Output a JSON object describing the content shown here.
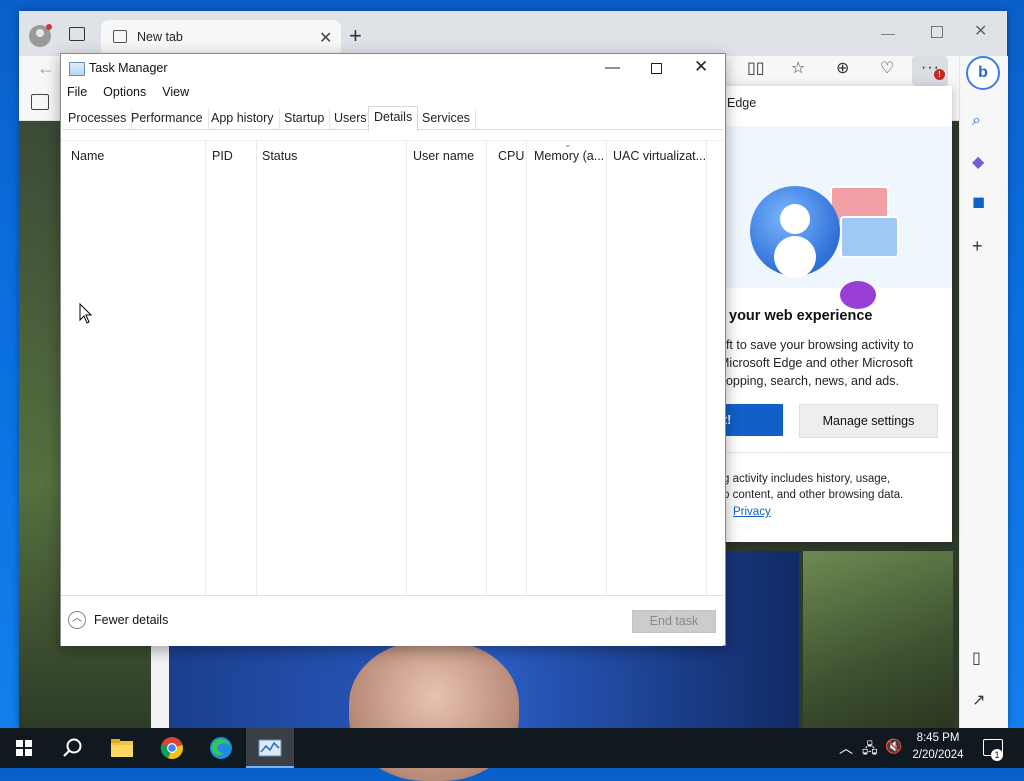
{
  "browser": {
    "tab_title": "New tab",
    "flyout": {
      "header": "Edge",
      "title": "your web experience",
      "body_lines": [
        "oft to save your browsing activity to",
        "Microsoft Edge and other Microsoft",
        "hopping, search, news, and ads."
      ],
      "primary_button": "t!",
      "secondary_button": "Manage settings",
      "footer_lines": [
        "g activity includes history, usage,",
        "o content, and other browsing data."
      ],
      "privacy_link": "Privacy"
    },
    "toolbar_badge": "!"
  },
  "task_manager": {
    "title": "Task Manager",
    "menu": [
      "File",
      "Options",
      "View"
    ],
    "tabs": [
      "Processes",
      "Performance",
      "App history",
      "Startup",
      "Users",
      "Details",
      "Services"
    ],
    "active_tab": "Details",
    "columns": [
      "Name",
      "PID",
      "Status",
      "User name",
      "CPU",
      "Memory (a...",
      "UAC virtualizat..."
    ],
    "fewer_details": "Fewer details",
    "end_task": "End task"
  },
  "taskbar": {
    "time": "8:45 PM",
    "date": "2/20/2024",
    "notification_count": "1",
    "pinned": [
      "start",
      "search",
      "file-explorer",
      "chrome",
      "edge",
      "task-manager"
    ]
  }
}
